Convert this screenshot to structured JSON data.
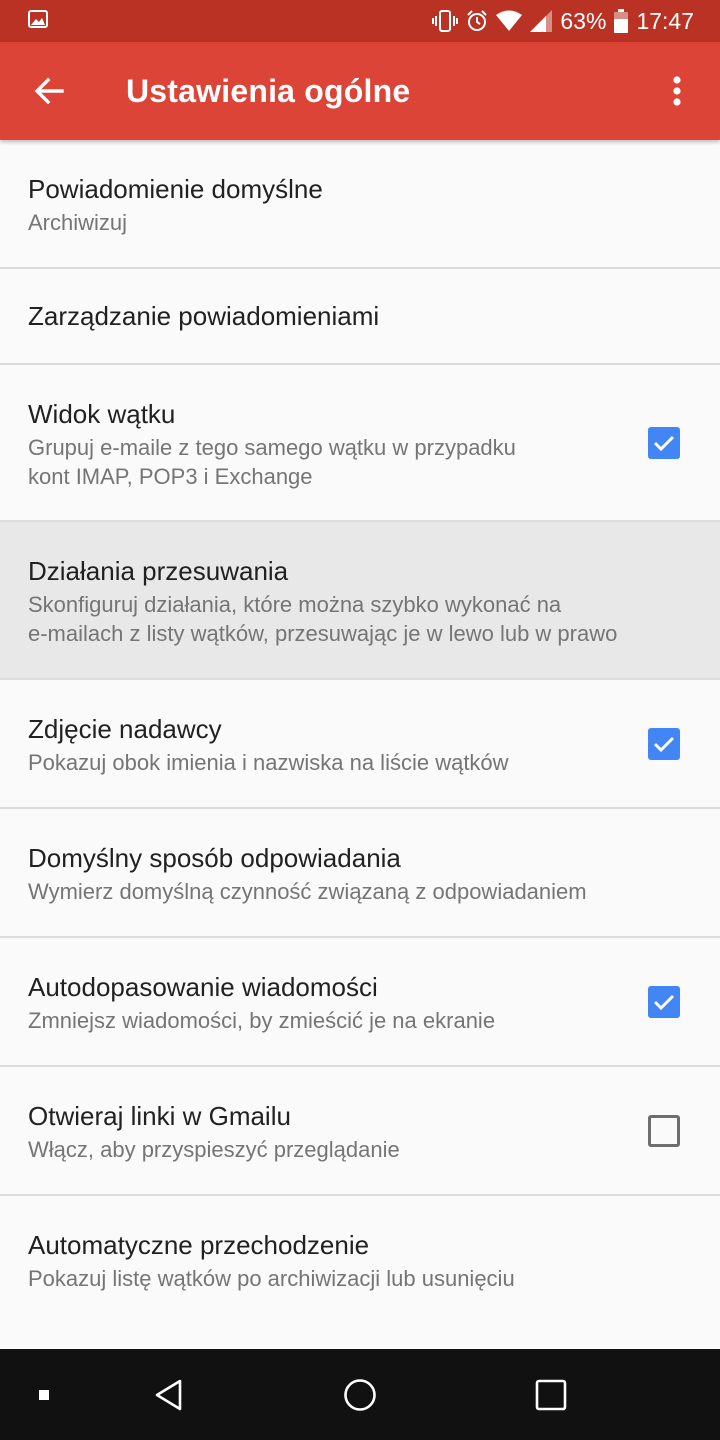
{
  "status_bar": {
    "battery_percent": "63%",
    "time": "17:47"
  },
  "app_bar": {
    "title": "Ustawienia ogólne",
    "back_icon": "arrow-back-icon",
    "menu_icon": "more-vert-icon"
  },
  "settings": [
    {
      "title": "Powiadomienie domyślne",
      "summary": "Archiwizuj"
    },
    {
      "title": "Zarządzanie powiadomieniami",
      "summary": ""
    },
    {
      "title": "Widok wątku",
      "summary": "Grupuj e-maile z tego samego wątku w przypadku\nkont IMAP, POP3 i Exchange",
      "checked": true
    },
    {
      "title": "Działania przesuwania",
      "summary": "Skonfiguruj działania, które można szybko wykonać na\ne-mailach z listy wątków, przesuwając je w lewo lub w prawo"
    },
    {
      "title": "Zdjęcie nadawcy",
      "summary": "Pokazuj obok imienia i nazwiska na liście wątków",
      "checked": true
    },
    {
      "title": "Domyślny sposób odpowiadania",
      "summary": "Wymierz domyślną czynność związaną z odpowiadaniem"
    },
    {
      "title": "Autodopasowanie wiadomości",
      "summary": "Zmniejsz wiadomości, by zmieścić je na ekranie",
      "checked": true
    },
    {
      "title": "Otwieraj linki w Gmailu",
      "summary": "Włącz, aby przyspieszyć przeglądanie",
      "checked": false
    },
    {
      "title": "Automatyczne przechodzenie",
      "summary": "Pokazuj listę wątków po archiwizacji lub usunięciu"
    }
  ],
  "colors": {
    "status_bar": "#b93224",
    "app_bar": "#db4437",
    "checkbox_checked": "#4285f4"
  }
}
